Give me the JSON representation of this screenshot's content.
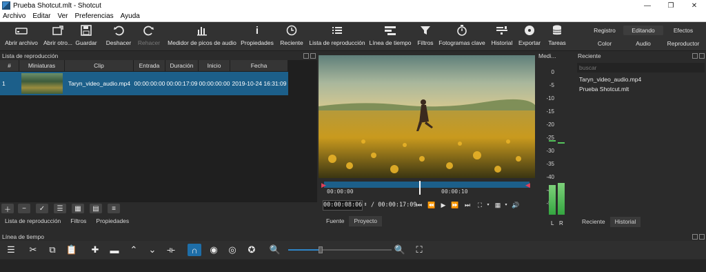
{
  "window": {
    "title": "Prueba Shotcut.mlt - Shotcut"
  },
  "menu": [
    "Archivo",
    "Editar",
    "Ver",
    "Preferencias",
    "Ayuda"
  ],
  "toolbar": {
    "open_file": "Abrir archivo",
    "open_other": "Abrir otro...",
    "save": "Guardar",
    "undo": "Deshacer",
    "redo": "Rehacer",
    "peak_meter": "Medidor de picos de audio",
    "properties": "Propiedades",
    "recent": "Reciente",
    "playlist": "Lista de reproducción",
    "timeline": "Línea de tiempo",
    "filters": "Filtros",
    "keyframes": "Fotogramas clave",
    "history": "Historial",
    "export": "Exportar",
    "jobs": "Tareas"
  },
  "layouts": {
    "logging": "Registro",
    "editing": "Editando",
    "effects": "Efectos",
    "color": "Color",
    "audio": "Audio",
    "player": "Reproductor"
  },
  "playlist": {
    "title": "Lista de reproducción",
    "columns": [
      "#",
      "Miniaturas",
      "Clip",
      "Entrada",
      "Duración",
      "Inicio",
      "Fecha"
    ],
    "rows": [
      {
        "num": "1",
        "clip": "Taryn_video_audio.mp4",
        "in": "00:00:00:00",
        "duration": "00:00:17:09",
        "start": "00:00:00:00",
        "date": "2019-10-24 16:31:09"
      }
    ],
    "tabs": [
      "Lista de reproducción",
      "Filtros",
      "Propiedades"
    ]
  },
  "player": {
    "ruler_start": "00:00:00",
    "ruler_mid": "00:00:10",
    "current_time": "00:00:08:06",
    "total_time": "/ 00:00:17:09",
    "tabs": [
      "Fuente",
      "Proyecto"
    ]
  },
  "meter": {
    "title": "Medi...",
    "scale": [
      "0",
      "-5",
      "-10",
      "-15",
      "-20",
      "-25",
      "-30",
      "-35",
      "-40",
      "-45",
      "-50"
    ],
    "left_label": "L",
    "right_label": "R",
    "left_level_db": -43,
    "right_level_db": -42
  },
  "recent": {
    "title": "Reciente",
    "search_placeholder": "buscar",
    "items": [
      "Taryn_video_audio.mp4",
      "Prueba Shotcut.mlt"
    ],
    "tabs": [
      "Reciente",
      "Historial"
    ]
  },
  "timeline": {
    "title": "Línea de tiempo"
  }
}
